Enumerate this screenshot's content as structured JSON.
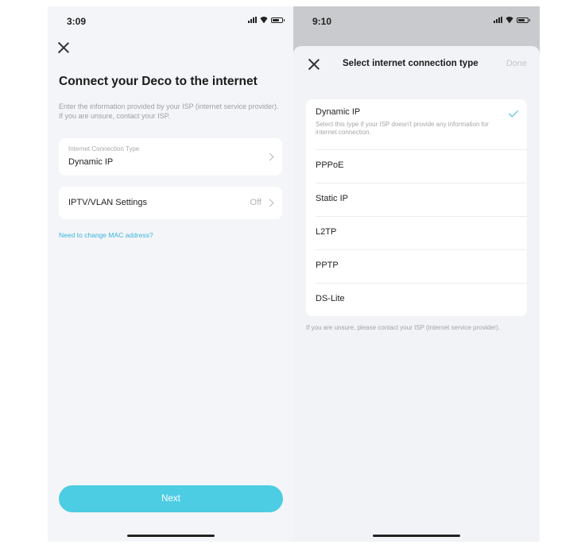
{
  "left": {
    "status": {
      "time": "3:09"
    },
    "title": "Connect your Deco to the internet",
    "description": "Enter the information provided by your ISP (internet service provider). If you are unsure, contact your ISP.",
    "connection": {
      "label": "Internet Connection Type",
      "value": "Dynamic IP"
    },
    "iptv": {
      "label": "IPTV/VLAN Settings",
      "value": "Off"
    },
    "mac_link": "Need to change MAC address?",
    "next_label": "Next"
  },
  "right": {
    "status": {
      "time": "9:10"
    },
    "title": "Select internet connection type",
    "done_label": "Done",
    "options": [
      {
        "name": "Dynamic IP",
        "hint": "Select this type if your ISP doesn't provide any information for internet connection.",
        "selected": true
      },
      {
        "name": "PPPoE"
      },
      {
        "name": "Static IP"
      },
      {
        "name": "L2TP"
      },
      {
        "name": "PPTP"
      },
      {
        "name": "DS-Lite"
      }
    ],
    "footer": "If you are unsure, please contact your ISP (internet service provider)."
  },
  "colors": {
    "accent": "#39b6dc",
    "button": "#4dcde4"
  },
  "icons": [
    "close-icon",
    "chevron-right-icon",
    "checkmark-icon",
    "signal-icon",
    "wifi-icon",
    "battery-icon"
  ]
}
